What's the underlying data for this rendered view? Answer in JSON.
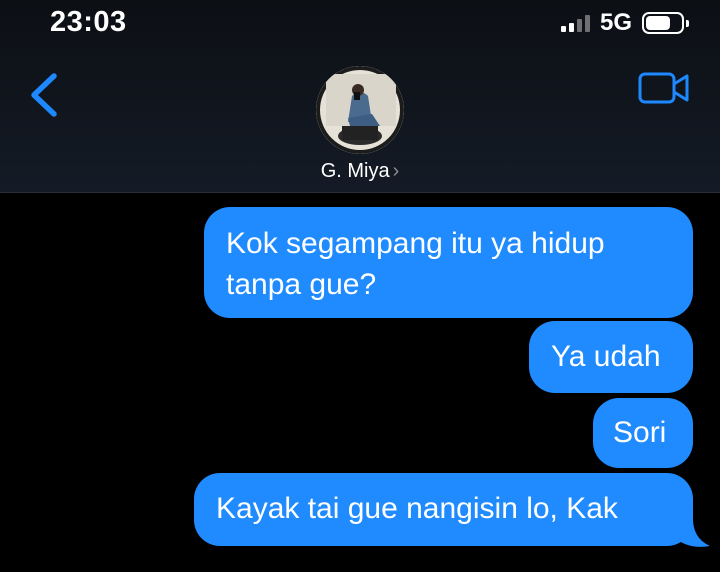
{
  "status_bar": {
    "time": "23:03",
    "network": "5G",
    "signal_bars": 2,
    "icons": [
      "signal-icon",
      "battery-icon"
    ]
  },
  "header": {
    "back_icon": "chevron-left-icon",
    "video_icon": "video-camera-icon",
    "contact_name": "G. Miya",
    "contact_chevron": "›"
  },
  "messages": [
    {
      "direction": "outgoing",
      "lines": [
        "Kok segampang itu ya hidup",
        "tanpa gue?"
      ]
    },
    {
      "direction": "outgoing",
      "text": "Ya udah"
    },
    {
      "direction": "outgoing",
      "text": "Sori"
    },
    {
      "direction": "outgoing",
      "text": "Kayak tai gue nangisin lo, Kak"
    }
  ],
  "colors": {
    "bubble": "#1f8bff",
    "accent": "#1e88ff",
    "background": "#000000",
    "header_bg": "#131a24"
  }
}
